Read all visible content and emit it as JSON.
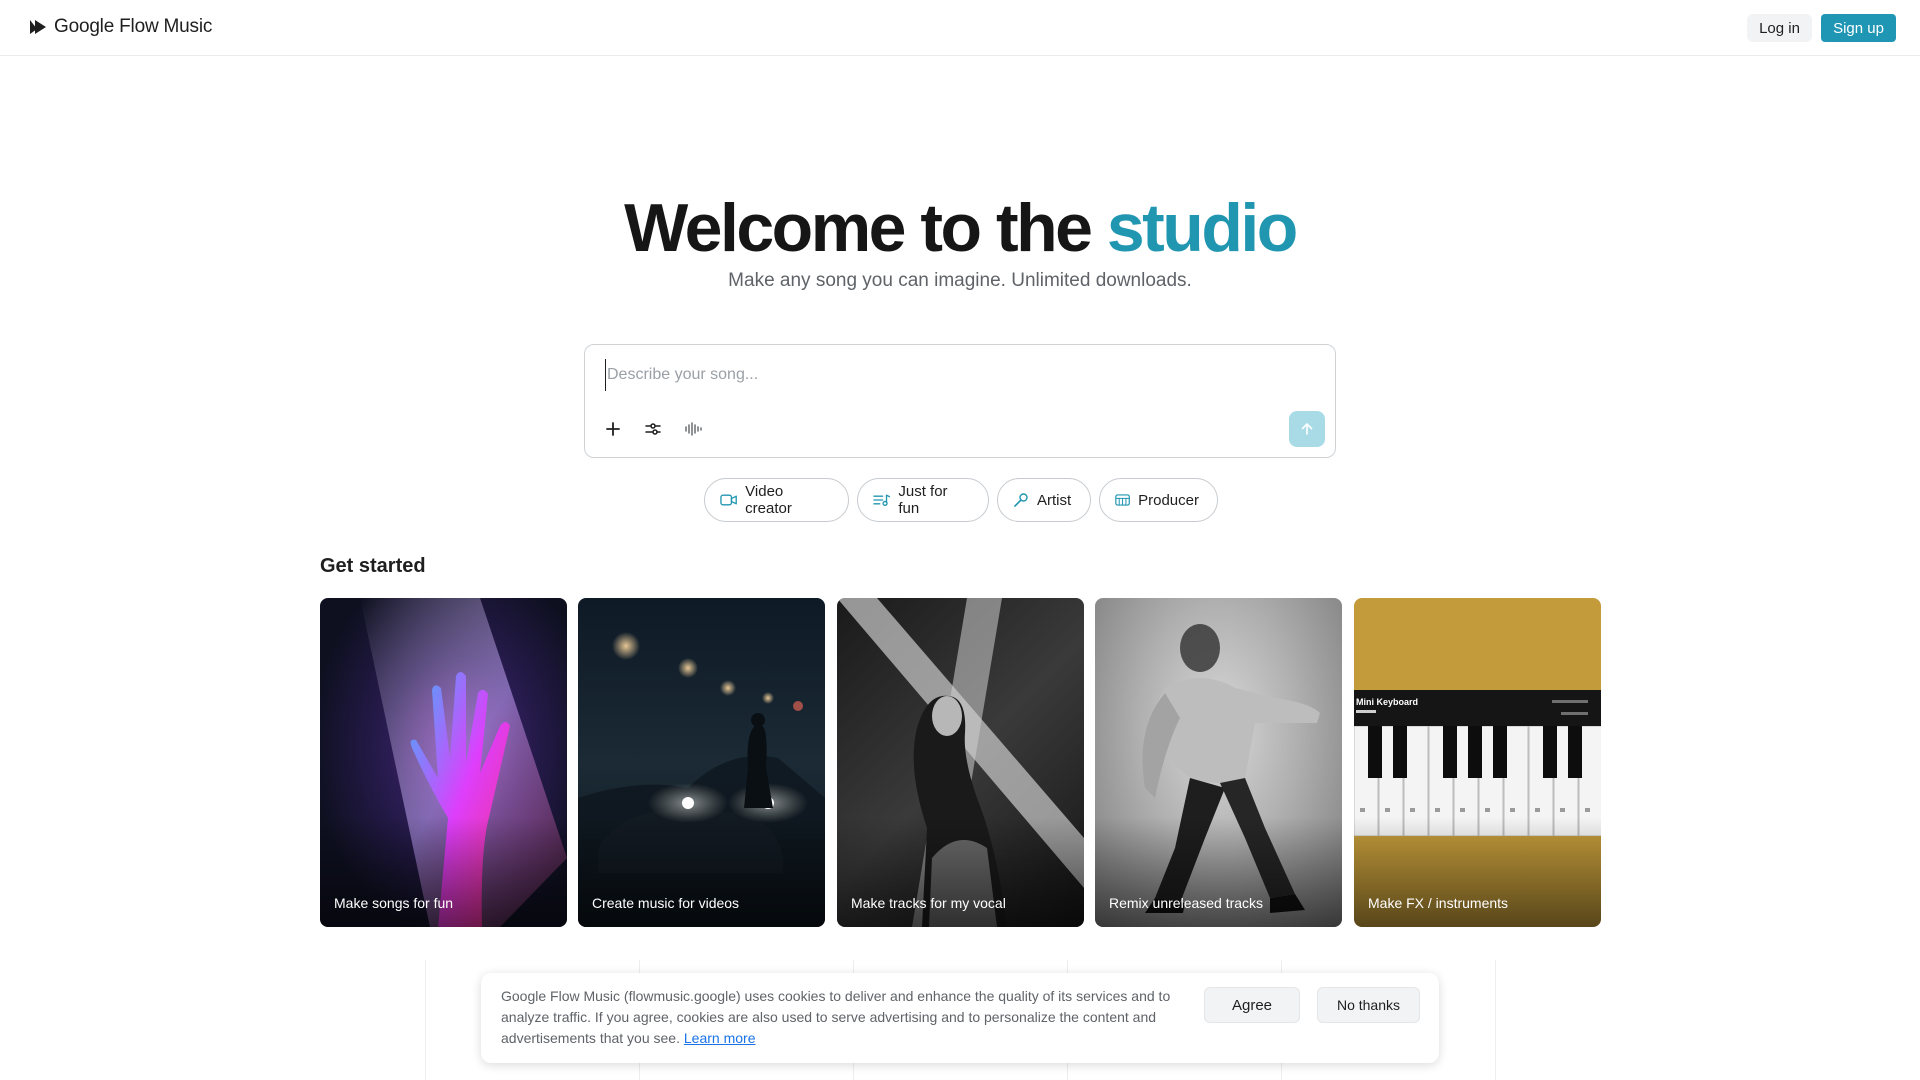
{
  "header": {
    "brand_name": "Google Flow Music",
    "login_label": "Log in",
    "signup_label": "Sign up"
  },
  "hero": {
    "title_main": "Welcome to the ",
    "title_accent": "studio",
    "subtitle": "Make any song you can imagine. Unlimited downloads."
  },
  "prompt": {
    "placeholder": "Describe your song...",
    "value": "",
    "tools": [
      "plus-icon",
      "sliders-icon",
      "waveform-icon"
    ],
    "send_icon": "arrow-up-icon"
  },
  "chips": [
    {
      "label": "Video creator",
      "icon": "video-camera-icon"
    },
    {
      "label": "Just for fun",
      "icon": "playlist-music-icon"
    },
    {
      "label": "Artist",
      "icon": "microphone-icon"
    },
    {
      "label": "Producer",
      "icon": "keyboard-icon"
    }
  ],
  "get_started": {
    "title": "Get started",
    "cards": [
      {
        "label": "Make songs for fun"
      },
      {
        "label": "Create music for videos"
      },
      {
        "label": "Make tracks for my vocal"
      },
      {
        "label": "Remix unreleased tracks"
      },
      {
        "label": "Make FX / instruments"
      }
    ],
    "mini_keyboard_title": "Mini Keyboard"
  },
  "cookie": {
    "text": "Google Flow Music (flowmusic.google) uses cookies to deliver and enhance the quality of its services and to analyze traffic. If you agree, cookies are also used to serve advertising and to personalize the content and advertisements that you see.",
    "learn_more": "Learn more",
    "agree_label": "Agree",
    "no_thanks_label": "No thanks"
  },
  "colors": {
    "accent": "#2196b0",
    "signup_button": "#1e96b4",
    "send_button": "#a8dbe6"
  }
}
